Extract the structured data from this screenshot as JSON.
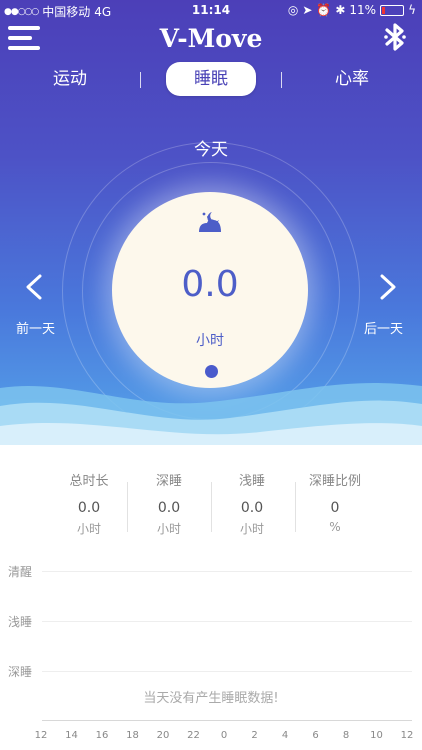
{
  "status_bar": {
    "carrier": "中国移动",
    "network": "4G",
    "time": "11:14",
    "battery": "11%"
  },
  "header": {
    "title": "V-Move",
    "menu_icon": "hamburger-menu-icon",
    "bluetooth_icon": "bluetooth-icon"
  },
  "tabs": [
    {
      "label": "运动"
    },
    {
      "label": "睡眠"
    },
    {
      "label": "心率"
    }
  ],
  "day": {
    "label": "今天",
    "prev_label": "前一天",
    "next_label": "后一天"
  },
  "summary": {
    "icon": "sleep-moon-icon",
    "value": "0.0",
    "unit": "小时"
  },
  "stats": [
    {
      "label": "总时长",
      "value": "0.0",
      "unit": "小时"
    },
    {
      "label": "深睡",
      "value": "0.0",
      "unit": "小时"
    },
    {
      "label": "浅睡",
      "value": "0.0",
      "unit": "小时"
    },
    {
      "label": "深睡比例",
      "value": "0",
      "unit": "%"
    }
  ],
  "chart": {
    "levels": [
      "清醒",
      "浅睡",
      "深睡"
    ],
    "empty_message": "当天没有产生睡眠数据!",
    "x_ticks": [
      "12",
      "14",
      "16",
      "18",
      "20",
      "22",
      "0",
      "2",
      "4",
      "6",
      "8",
      "10",
      "12"
    ]
  },
  "colors": {
    "accent": "#4d5ec8",
    "hero_top": "#4c3fb8",
    "hero_bottom": "#56a6ea"
  }
}
